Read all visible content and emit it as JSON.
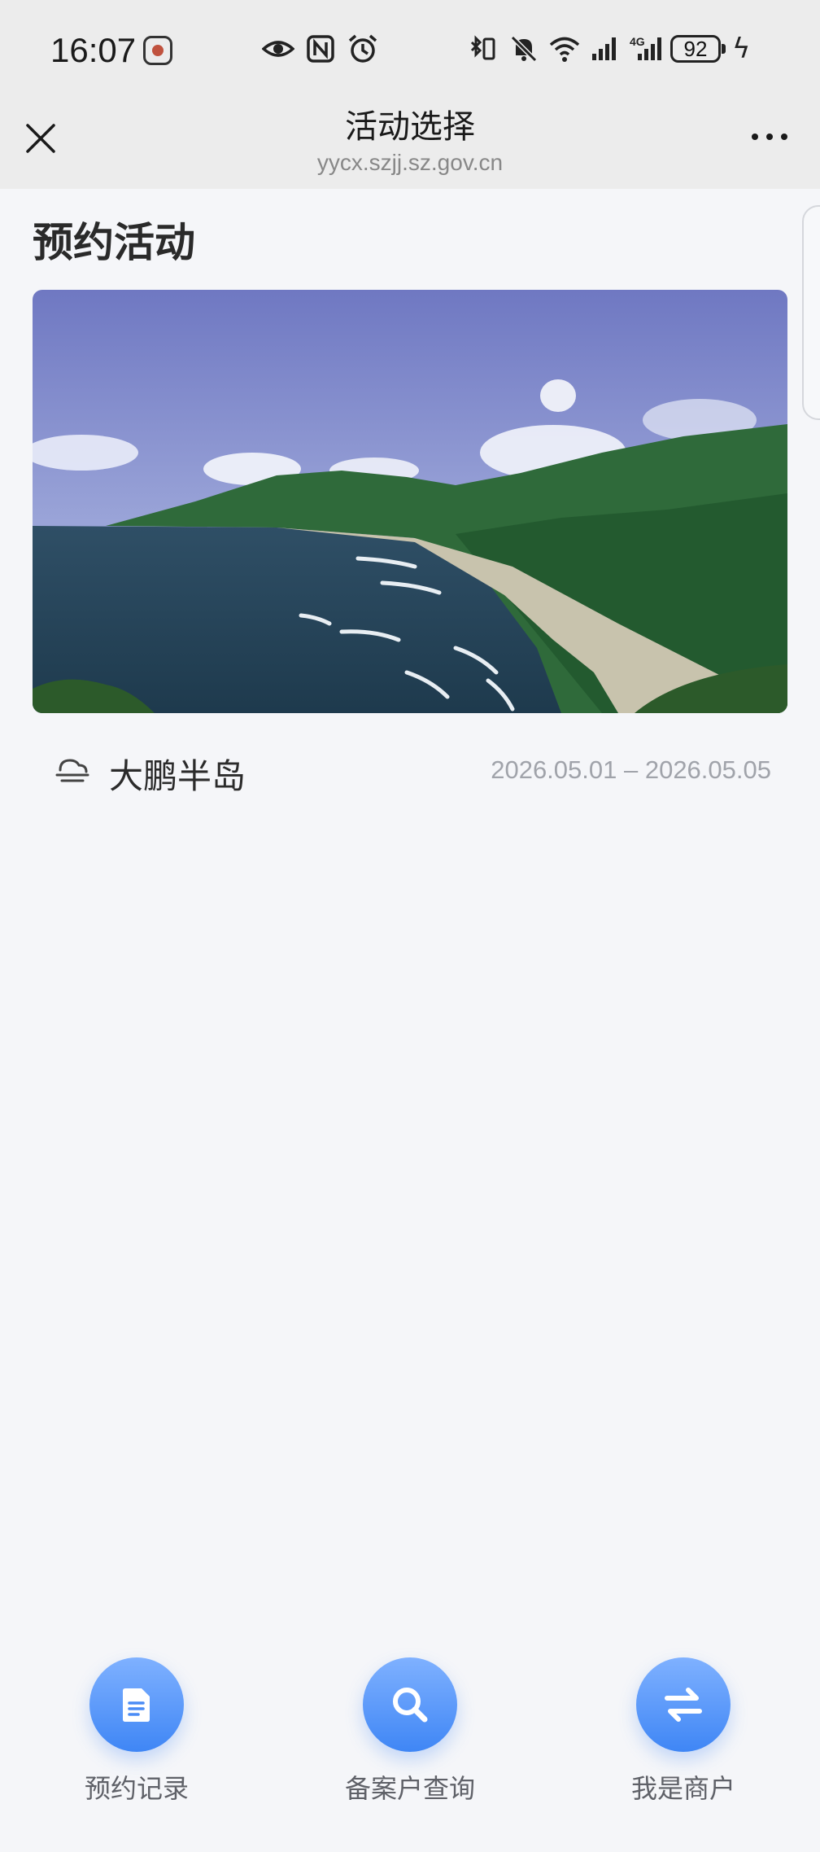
{
  "status_bar": {
    "time": "16:07",
    "battery": "92"
  },
  "header": {
    "title": "活动选择",
    "domain": "yycx.szjj.sz.gov.cn"
  },
  "main": {
    "section_title": "预约活动",
    "activities": [
      {
        "name": "大鹏半岛",
        "date_range": "2026.05.01 – 2026.05.05",
        "image": "coastal-bay-photo"
      }
    ]
  },
  "bottom_nav": {
    "items": [
      {
        "label": "预约记录",
        "icon": "document-icon"
      },
      {
        "label": "备案户查询",
        "icon": "search-icon"
      },
      {
        "label": "我是商户",
        "icon": "swap-icon"
      }
    ]
  },
  "colors": {
    "accent": "#3f86f5",
    "background": "#f5f6f9",
    "header_bg": "#ececec"
  }
}
